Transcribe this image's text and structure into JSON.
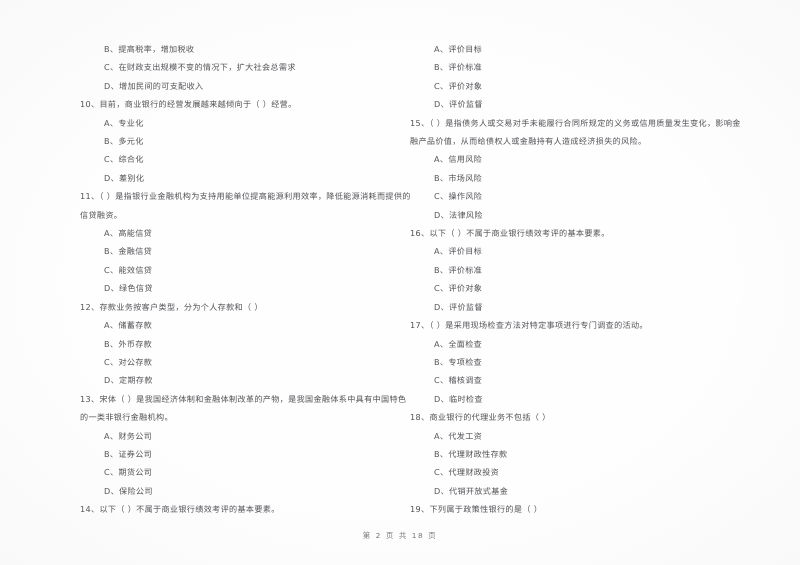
{
  "document": {
    "kind": "scanned-exam-paper",
    "footer": "第 2 页 共 18 页"
  },
  "left_column": {
    "lines": [
      {
        "type": "option",
        "text": "B、提高税率，增加税收"
      },
      {
        "type": "option",
        "text": "C、在财政支出规模不变的情况下，扩大社会总需求"
      },
      {
        "type": "option",
        "text": "D、增加民间的可支配收入"
      },
      {
        "type": "question",
        "text": "10、目前，商业银行的经营发展越来越倾向于（      ）经营。"
      },
      {
        "type": "option",
        "text": "A、专业化"
      },
      {
        "type": "option",
        "text": "B、多元化"
      },
      {
        "type": "option",
        "text": "C、综合化"
      },
      {
        "type": "option",
        "text": "D、差别化"
      },
      {
        "type": "question",
        "text": "11、（      ）是指银行业金融机构为支持用能单位提高能源利用效率，降低能源消耗而提供的"
      },
      {
        "type": "continue",
        "text": "信贷融资。"
      },
      {
        "type": "option",
        "text": "A、高能信贷"
      },
      {
        "type": "option",
        "text": "B、金融信贷"
      },
      {
        "type": "option",
        "text": "C、能效信贷"
      },
      {
        "type": "option",
        "text": "D、绿色信贷"
      },
      {
        "type": "question",
        "text": "12、存款业务按客户类型，分为个人存款和（      ）"
      },
      {
        "type": "option",
        "text": "A、储蓄存款"
      },
      {
        "type": "option",
        "text": "B、外币存款"
      },
      {
        "type": "option",
        "text": "C、对公存款"
      },
      {
        "type": "option",
        "text": "D、定期存款"
      },
      {
        "type": "question",
        "text": "13、宋体（        ）是我国经济体制和金融体制改革的产物，是我国金融体系中具有中国特色"
      },
      {
        "type": "continue",
        "text": "的一类非银行金融机构。"
      },
      {
        "type": "option",
        "text": "A、财务公司"
      },
      {
        "type": "option",
        "text": "B、证券公司"
      },
      {
        "type": "option",
        "text": "C、期货公司"
      },
      {
        "type": "option",
        "text": "D、保险公司"
      },
      {
        "type": "question",
        "text": "14、以下（      ）不属于商业银行绩效考评的基本要素。"
      }
    ]
  },
  "right_column": {
    "lines": [
      {
        "type": "option",
        "text": "A、评价目标"
      },
      {
        "type": "option",
        "text": "B、评价标准"
      },
      {
        "type": "option",
        "text": "C、评价对象"
      },
      {
        "type": "option",
        "text": "D、评价监督"
      },
      {
        "type": "question",
        "text": "15、（      ）是指债务人或交易对手未能履行合同所规定的义务或信用质量发生变化，影响金"
      },
      {
        "type": "continue",
        "text": "融产品价值，从而给债权人或金融持有人造成经济损失的风险。"
      },
      {
        "type": "option",
        "text": "A、信用风险"
      },
      {
        "type": "option",
        "text": "B、市场风险"
      },
      {
        "type": "option",
        "text": "C、操作风险"
      },
      {
        "type": "option",
        "text": "D、法律风险"
      },
      {
        "type": "question",
        "text": "16、以下（      ）不属于商业银行绩效考评的基本要素。"
      },
      {
        "type": "option",
        "text": "A、评价目标"
      },
      {
        "type": "option",
        "text": "B、评价标准"
      },
      {
        "type": "option",
        "text": "C、评价对象"
      },
      {
        "type": "option",
        "text": "D、评价监督"
      },
      {
        "type": "question",
        "text": "17、（      ）是采用现场检查方法对特定事项进行专门调查的活动。"
      },
      {
        "type": "option",
        "text": "A、全面检查"
      },
      {
        "type": "option",
        "text": "B、专项检查"
      },
      {
        "type": "option",
        "text": "C、稽核调查"
      },
      {
        "type": "option",
        "text": "D、临时检查"
      },
      {
        "type": "question",
        "text": "18、商业银行的代理业务不包括（      ）"
      },
      {
        "type": "option",
        "text": "A、代发工资"
      },
      {
        "type": "option",
        "text": "B、代理财政性存款"
      },
      {
        "type": "option",
        "text": "C、代理财政投资"
      },
      {
        "type": "option",
        "text": "D、代销开放式基金"
      },
      {
        "type": "question",
        "text": "19、下列属于政策性银行的是（      ）"
      }
    ]
  }
}
